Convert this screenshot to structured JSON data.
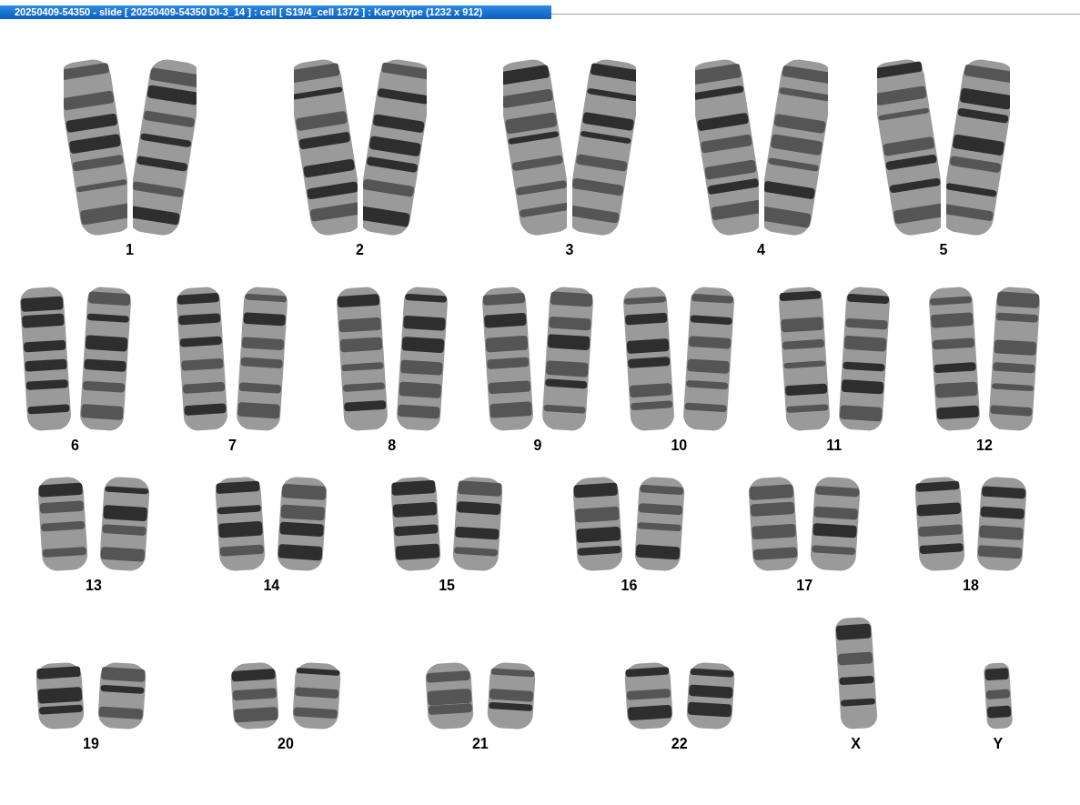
{
  "window": {
    "title": "20250409-54350 - slide [ 20250409-54350 DI-3_14 ] : cell [ S19/4_cell 1372 ] : Karyotype  (1232 x 912)"
  },
  "karyotype": {
    "rows": [
      {
        "groups": [
          {
            "label": "1",
            "kind": "pair"
          },
          {
            "label": "2",
            "kind": "pair"
          },
          {
            "label": "3",
            "kind": "pair"
          },
          {
            "label": "4",
            "kind": "pair"
          },
          {
            "label": "5",
            "kind": "pair"
          }
        ]
      },
      {
        "groups": [
          {
            "label": "6",
            "kind": "pair"
          },
          {
            "label": "7",
            "kind": "pair"
          },
          {
            "label": "8",
            "kind": "pair"
          },
          {
            "label": "9",
            "kind": "pair"
          },
          {
            "label": "10",
            "kind": "pair"
          },
          {
            "label": "11",
            "kind": "pair"
          },
          {
            "label": "12",
            "kind": "pair"
          }
        ]
      },
      {
        "groups": [
          {
            "label": "13",
            "kind": "pair"
          },
          {
            "label": "14",
            "kind": "pair"
          },
          {
            "label": "15",
            "kind": "pair"
          },
          {
            "label": "16",
            "kind": "pair"
          },
          {
            "label": "17",
            "kind": "pair"
          },
          {
            "label": "18",
            "kind": "pair"
          }
        ]
      },
      {
        "groups": [
          {
            "label": "19",
            "kind": "pair"
          },
          {
            "label": "20",
            "kind": "pair"
          },
          {
            "label": "21",
            "kind": "pair"
          },
          {
            "label": "22",
            "kind": "pair"
          },
          {
            "label": "X",
            "kind": "single"
          },
          {
            "label": "Y",
            "kind": "single"
          }
        ]
      }
    ]
  }
}
